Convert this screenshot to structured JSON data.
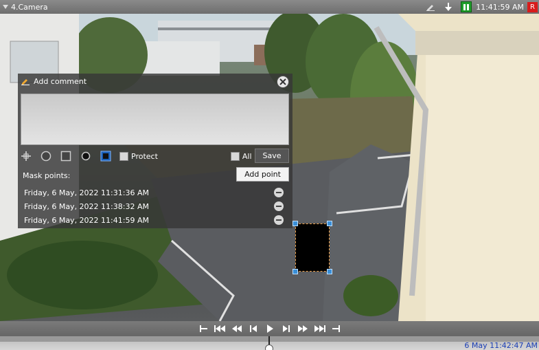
{
  "window": {
    "camera_title": "4.Camera",
    "clock": "11:41:59 AM",
    "rec_badge": "R"
  },
  "comment_panel": {
    "title": "Add comment",
    "comment_value": "",
    "protect_label": "Protect",
    "all_label": "All",
    "save_label": "Save",
    "add_point_label": "Add point",
    "mask_points_label": "Mask points:",
    "mask_points": [
      "Friday, 6 May, 2022 11:31:36 AM",
      "Friday, 6 May, 2022 11:38:32 AM",
      "Friday, 6 May, 2022 11:41:59 AM"
    ]
  },
  "timeline": {
    "current_time": "6 May 11:42:47 AM"
  },
  "colors": {
    "accent_green": "#1f9d2a",
    "rec_red": "#d81c1c",
    "handle_blue": "#3a8fd8",
    "mask_border": "#f0a24a",
    "timeline_text": "#1b3fb5"
  },
  "icons": [
    "dropdown-triangle-icon",
    "edit-icon",
    "download-arrow-icon",
    "pause-icon",
    "pencil-icon",
    "close-icon",
    "crosshair-icon",
    "circle-tool-icon",
    "square-tool-icon",
    "dot-tool-icon",
    "filled-square-tool-icon",
    "minus-icon",
    "go-start-icon",
    "frame-back-icon",
    "play-icon",
    "frame-forward-icon",
    "go-end-icon"
  ]
}
